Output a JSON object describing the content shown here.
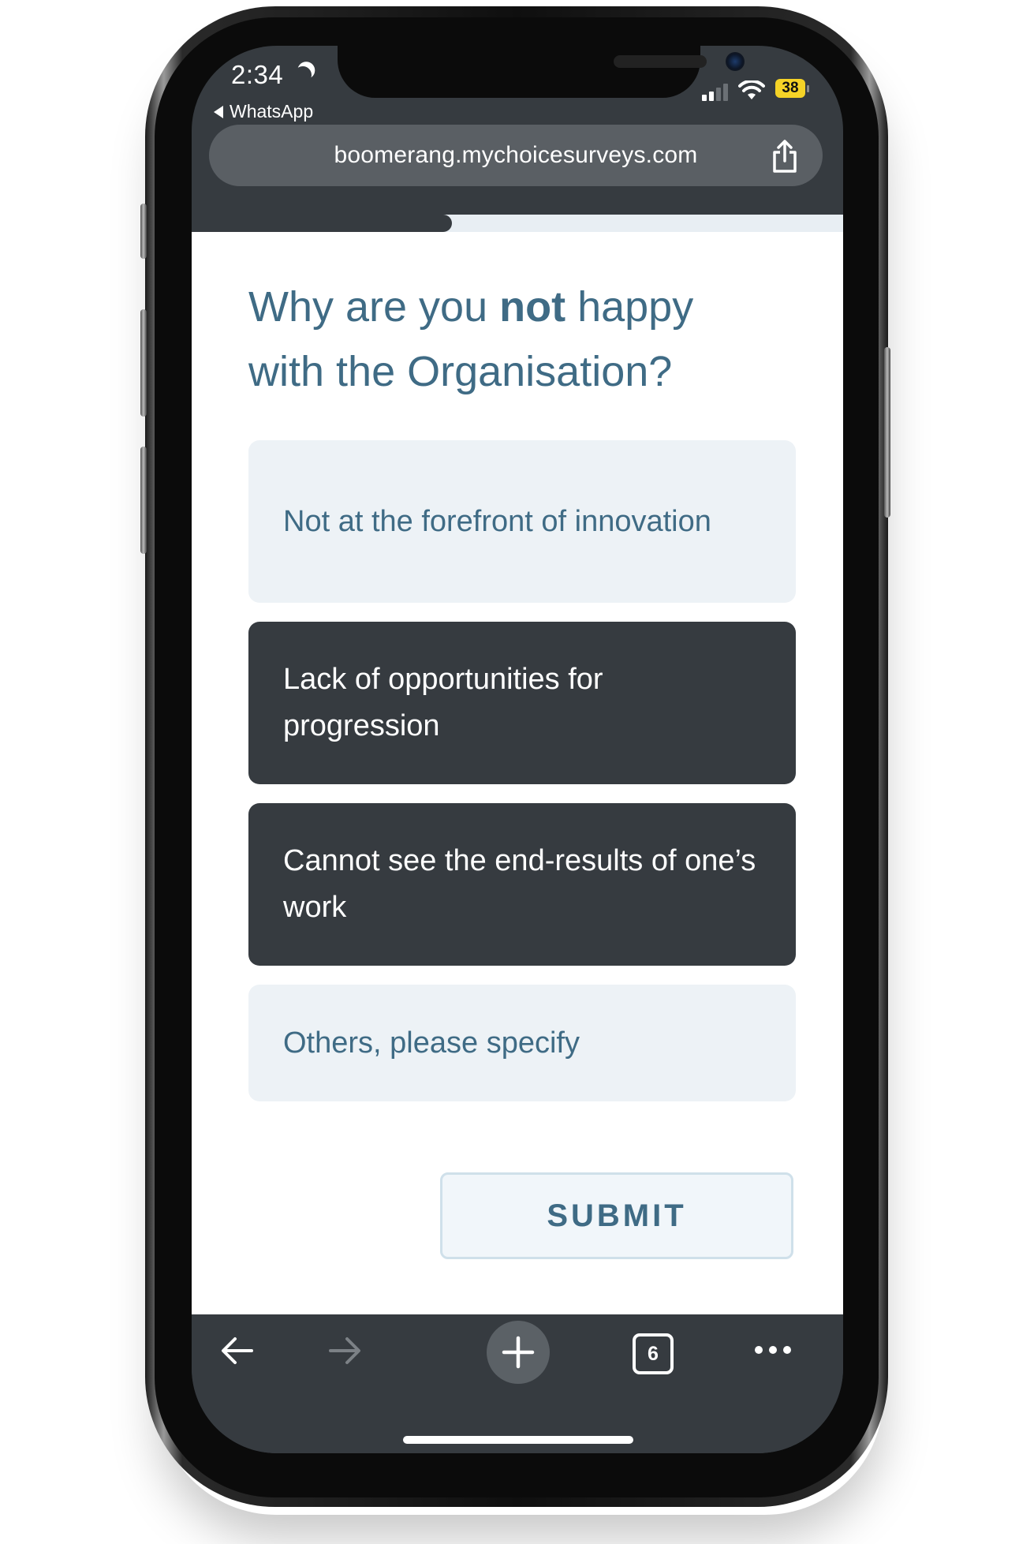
{
  "status_bar": {
    "time": "2:34",
    "back_app": "WhatsApp",
    "battery": "38"
  },
  "browser": {
    "url": "boomerang.mychoicesurveys.com",
    "tab_count": "6"
  },
  "survey": {
    "progress_fraction": 0.4,
    "question": {
      "prefix": "Why are you ",
      "emphasis": "not",
      "suffix": " happy with the Organisation?"
    },
    "options": [
      {
        "label": "Not at the forefront of innovation",
        "selected": false
      },
      {
        "label": "Lack of opportunities for progression",
        "selected": true
      },
      {
        "label": "Cannot see the end-results of one’s work",
        "selected": true
      },
      {
        "label": "Others, please specify",
        "selected": false
      }
    ],
    "submit_label": "SUBMIT"
  },
  "colors": {
    "accent_text": "#3f6b85",
    "selected_bg": "#363b40",
    "unselected_bg": "#edf2f6"
  }
}
